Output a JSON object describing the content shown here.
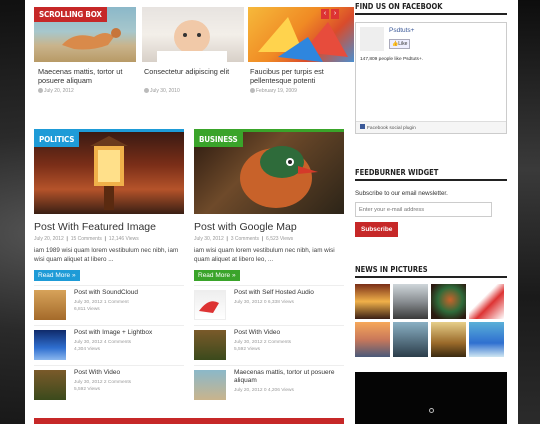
{
  "scrolling_box": {
    "label": "SCROLLING BOX",
    "prev": "‹",
    "next": "›",
    "items": [
      {
        "title": "Maecenas mattis, tortor ut posuere aliquam",
        "date": "July 20, 2012"
      },
      {
        "title": "Consectetur adipiscing elit",
        "date": "July 30, 2010"
      },
      {
        "title": "Faucibus per turpis est pellentesque potenti",
        "date": "February 19, 2009"
      }
    ]
  },
  "politics": {
    "label": "POLITICS",
    "color": "#1e9bd7",
    "title": "Post With Featured Image",
    "meta": "July 20, 2012  ❙ 15 Comments  ❙ 12,146 Views",
    "excerpt": "iam 1989 wisi quam lorem vestibulum nec nibh, iam wisi quam aliquet at libero ...",
    "read_more": "Read More »",
    "posts": [
      {
        "title": "Post with SoundCloud",
        "meta1": "July 30, 2012   1 Comment",
        "meta2": "6,811 Views"
      },
      {
        "title": "Post with Image + Lightbox",
        "meta1": "July 30, 2012   4 Comments",
        "meta2": "4,304 Views"
      },
      {
        "title": "Post With Video",
        "meta1": "July 30, 2012   2 Comments",
        "meta2": "5,592 Views"
      }
    ]
  },
  "business": {
    "label": "BUSINESS",
    "color": "#3aa42a",
    "title": "Post with Google Map",
    "meta": "July 30, 2012  ❙ 3 Comments  ❙ 6,523 Views",
    "excerpt": "iam wisi quam lorem vestibulum nec nibh, iam wisi quam aliquet at libero leo, ...",
    "read_more": "Read More »",
    "posts": [
      {
        "title": "Post with Self Hosted Audio",
        "meta1": "July 30, 2012   0   6,338 Views",
        "meta2": ""
      },
      {
        "title": "Post With Video",
        "meta1": "July 30, 2012   2 Comments",
        "meta2": "5,592 Views"
      },
      {
        "title": "Maecenas mattis, tortor ut posuere aliquam",
        "meta1": "July 20, 2012   0   4,206 Views",
        "meta2": ""
      }
    ]
  },
  "sidebar": {
    "facebook_title": "FIND US ON FACEBOOK",
    "fb_name": "Psdtuts+",
    "fb_like": "👍Like",
    "fb_count": "147,809 people like Psdtuts+.",
    "fb_plugin": "Facebook social plugin",
    "feedburner_title": "FEEDBURNER WIDGET",
    "feedburner_text": "Subscribe to our email newsletter.",
    "email_placeholder": "Enter your e-mail address",
    "subscribe": "Subscribe",
    "pictures_title": "NEWS IN PICTURES"
  },
  "colors": {
    "scrolling_box": "#c62828",
    "politics": "#1e9bd7",
    "business": "#3aa42a"
  }
}
